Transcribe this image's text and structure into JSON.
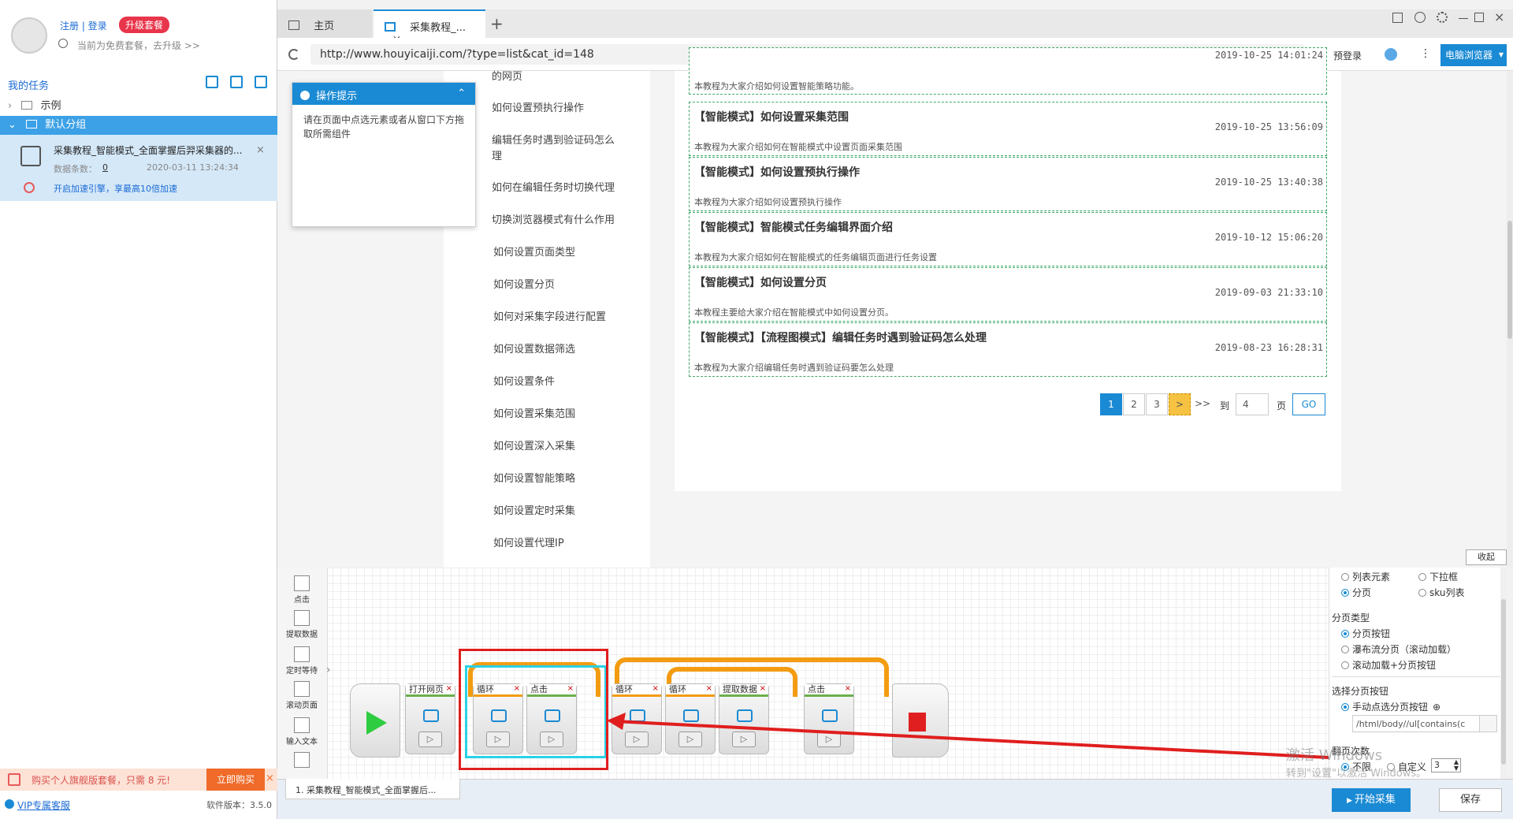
{
  "left": {
    "register_login": "注册 | 登录",
    "upgrade_badge": "升级套餐",
    "free_plan_note": "当前为免费套餐，去升级 >>",
    "my_tasks_label": "我的任务",
    "groups": [
      {
        "name": "示例",
        "expanded": false
      },
      {
        "name": "默认分组",
        "expanded": true
      }
    ],
    "task": {
      "title": "采集教程_智能模式_全面掌握后羿采集器的...",
      "data_count_label": "数据条数：",
      "data_count": "0",
      "timestamp": "2020-03-11 13:24:34",
      "speedup": "开启加速引擎，享最高10倍加速"
    },
    "promo": {
      "text": "购买个人旗舰版套餐，只需 8 元!",
      "buy": "立即购买"
    },
    "vip_support": "VIP专属客服",
    "version": "软件版本：3.5.0"
  },
  "browser": {
    "tabs": [
      {
        "label": "主页",
        "active": false
      },
      {
        "label": "采集教程_...",
        "active": true
      }
    ],
    "url": "http://www.houyicaiji.com/?type=list&cat_id=148",
    "prelogin": "预登录",
    "browser_mode": "电脑浏览器"
  },
  "tip": {
    "title": "操作提示",
    "body": "请在页面中点选元素或者从窗口下方拖取所需组件"
  },
  "menu": [
    "的网页",
    "如何设置预执行操作",
    "编辑任务时遇到验证码怎么",
    "理",
    "如何在编辑任务时切换代理",
    "切换浏览器模式有什么作用",
    "如何设置页面类型",
    "如何设置分页",
    "如何对采集字段进行配置",
    "如何设置数据筛选",
    "如何设置条件",
    "如何设置采集范围",
    "如何设置深入采集",
    "如何设置智能策略",
    "如何设置定时采集",
    "如何设置代理IP"
  ],
  "articles": [
    {
      "title": "",
      "date": "2019-10-25 14:01:24",
      "desc": "本教程为大家介绍如何设置智能策略功能。"
    },
    {
      "title": "【智能模式】如何设置采集范围",
      "date": "2019-10-25 13:56:09",
      "desc": "本教程为大家介绍如何在智能模式中设置页面采集范围"
    },
    {
      "title": "【智能模式】如何设置预执行操作",
      "date": "2019-10-25 13:40:38",
      "desc": "本教程为大家介绍如何设置预执行操作"
    },
    {
      "title": "【智能模式】智能模式任务编辑界面介绍",
      "date": "2019-10-12 15:06:20",
      "desc": "本教程为大家介绍如何在智能模式的任务编辑页面进行任务设置"
    },
    {
      "title": "【智能模式】如何设置分页",
      "date": "2019-09-03 21:33:10",
      "desc": "本教程主要给大家介绍在智能模式中如何设置分页。"
    },
    {
      "title": "【智能模式】【流程图模式】编辑任务时遇到验证码怎么处理",
      "date": "2019-08-23 16:28:31",
      "desc": "本教程为大家介绍编辑任务时遇到验证码要怎么处理"
    }
  ],
  "pagination": {
    "pages": [
      "1",
      "2",
      "3"
    ],
    "next": ">",
    "last": ">>",
    "to_label": "到",
    "page_input": "4",
    "page_suffix": "页",
    "go": "GO"
  },
  "toolbox": [
    "点击",
    "提取数据",
    "定时等待",
    "滚动页面",
    "输入文本"
  ],
  "flow_nodes": [
    "打开网页",
    "循环",
    "点击",
    "循环",
    "循环",
    "提取数据",
    "点击"
  ],
  "collapse": "收起",
  "right_panel": {
    "type_options": [
      "列表元素",
      "下拉框",
      "分页",
      "sku列表"
    ],
    "paging_type_label": "分页类型",
    "paging_types": [
      "分页按钮",
      "瀑布流分页（滚动加载）",
      "滚动加载+分页按钮"
    ],
    "select_button_label": "选择分页按钮",
    "manual_select": "手动点选分页按钮",
    "xpath": "/html/body//ul[contains(c",
    "page_count_label": "翻页次数",
    "unlimited": "不限",
    "custom": "自定义",
    "custom_value": "3"
  },
  "watermark": {
    "line1": "激活 Windows",
    "line2": "转到\"设置\"以激活 Windows。"
  },
  "bottom": {
    "task_tab": "1. 采集教程_智能模式_全面掌握后...",
    "start": "开始采集",
    "save": "保存"
  }
}
